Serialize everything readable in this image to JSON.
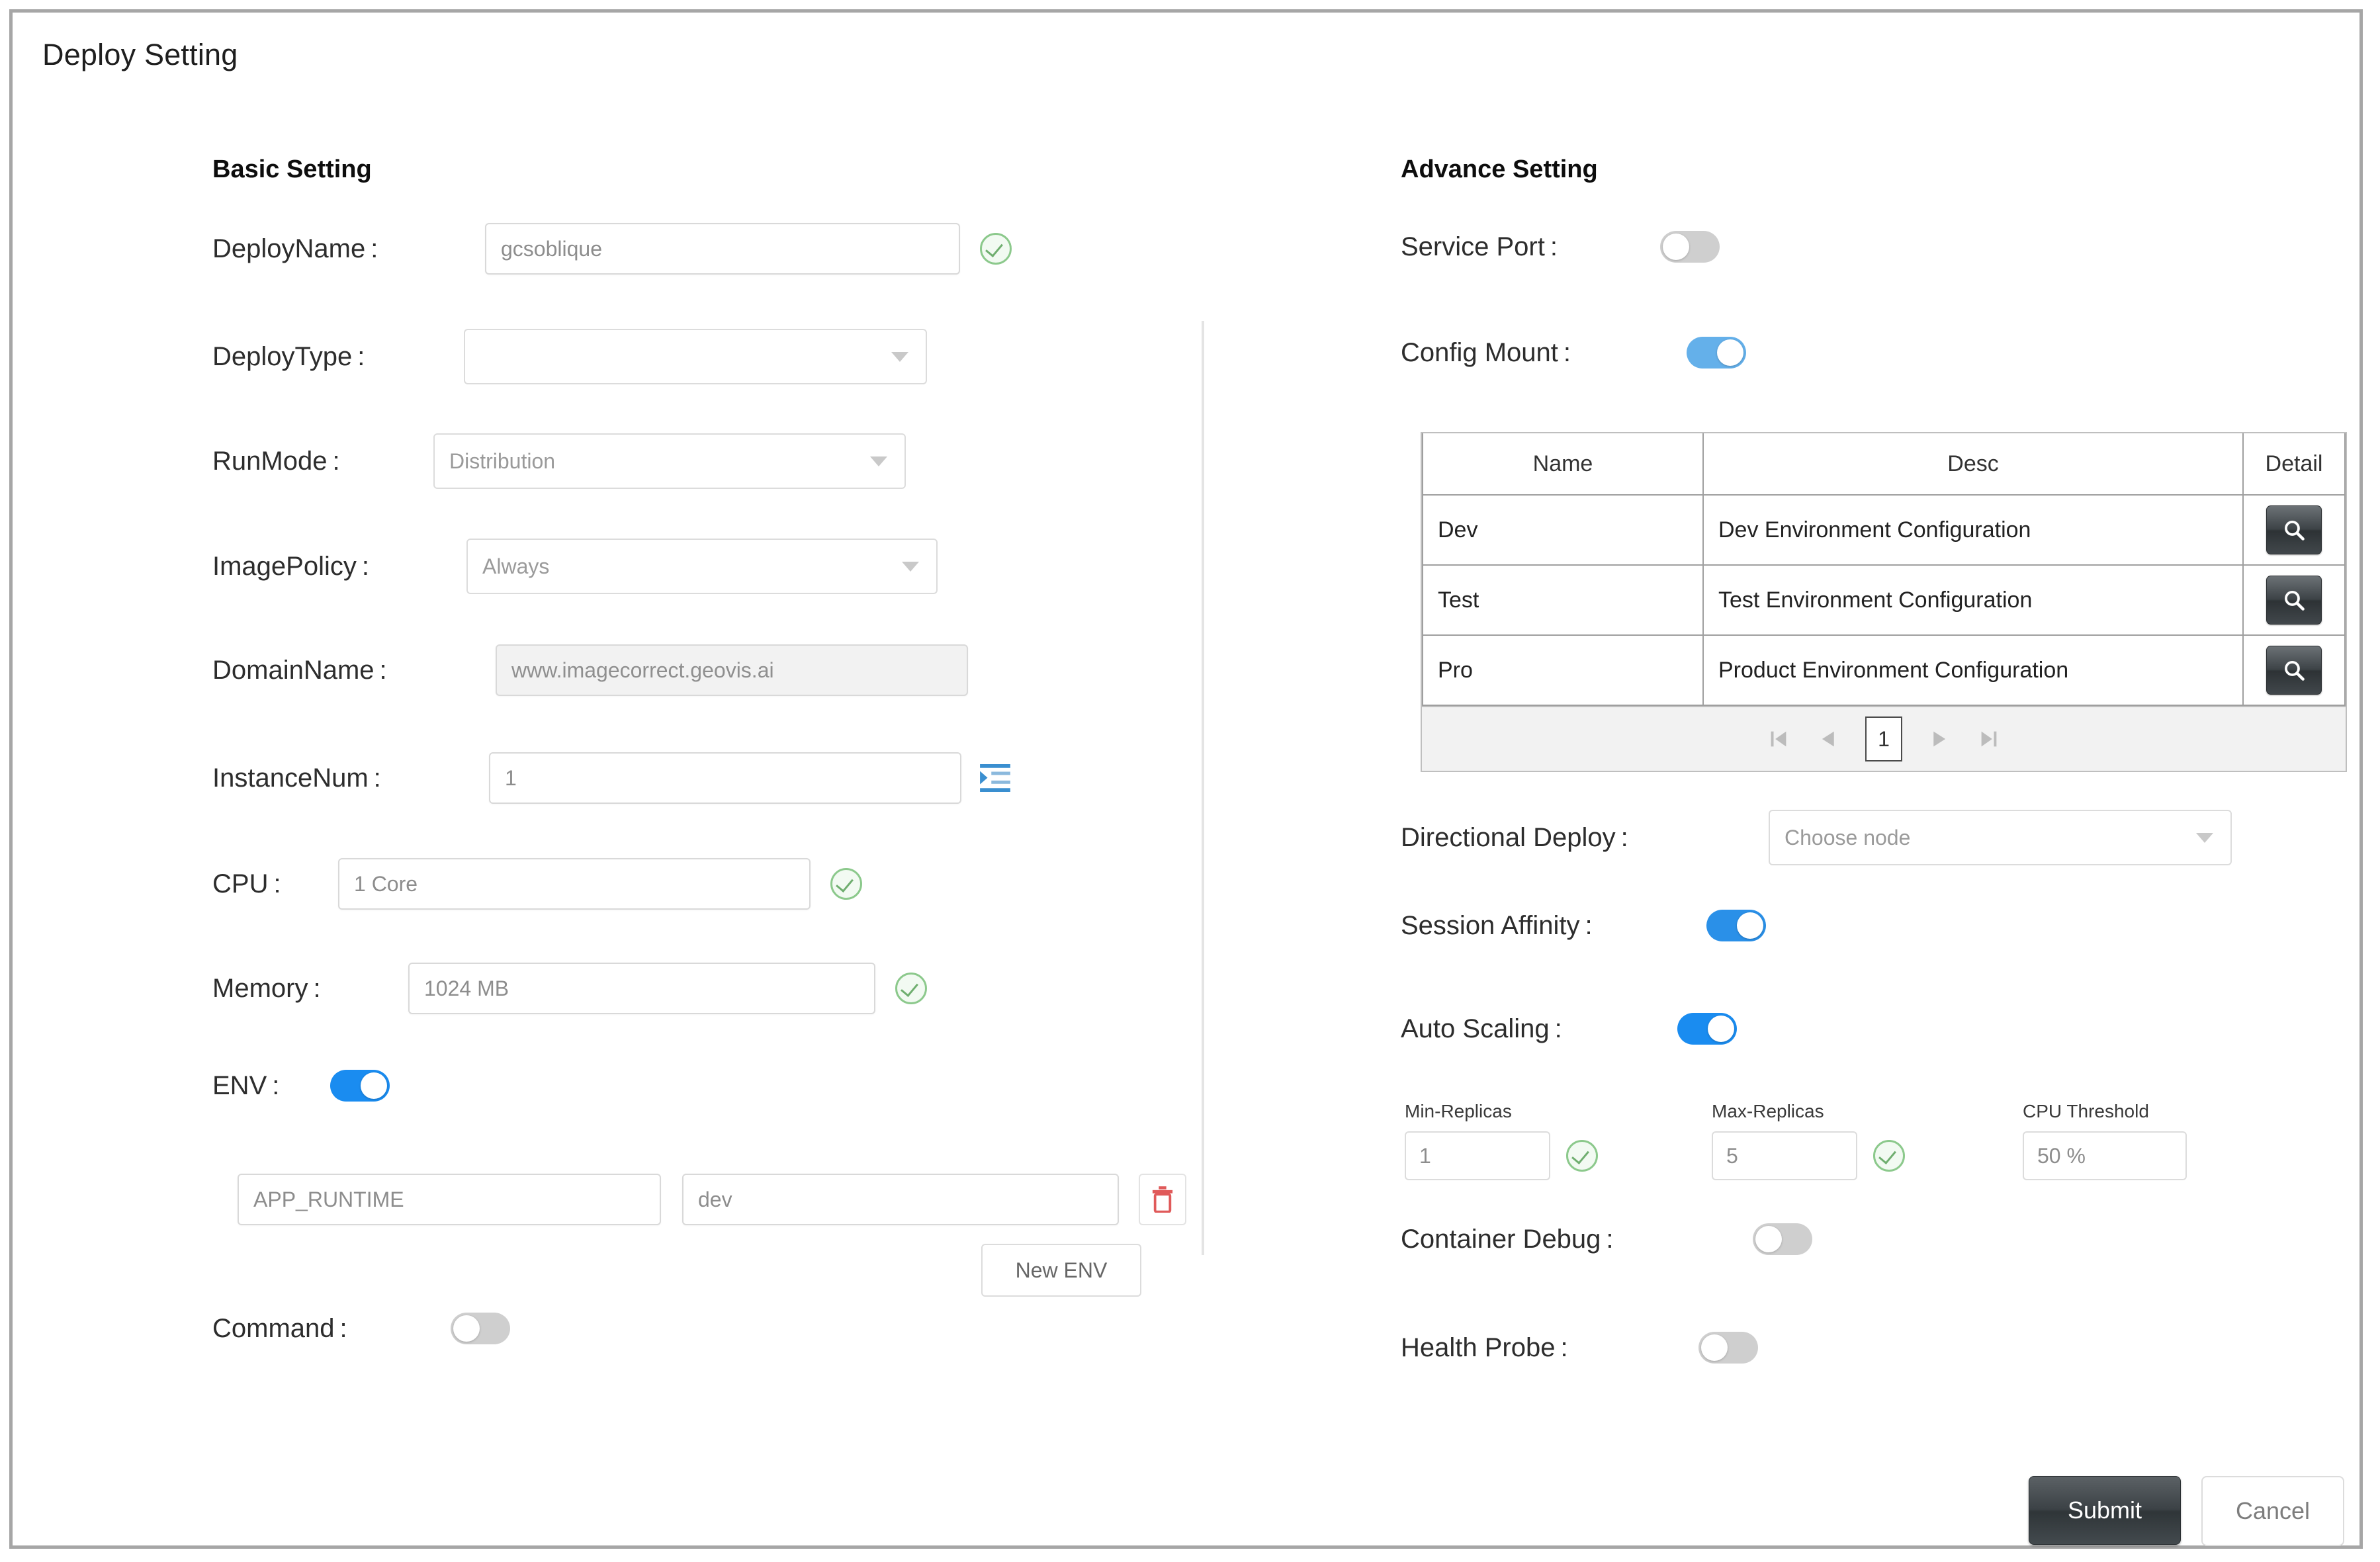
{
  "dialog": {
    "title": "Deploy Setting"
  },
  "basic": {
    "heading": "Basic Setting",
    "deploy_name": {
      "label": "DeployName :",
      "value": "gcsoblique",
      "valid": "valid-check-icon"
    },
    "deploy_type": {
      "label": "DeployType :",
      "value": "",
      "placeholder": ""
    },
    "run_mode": {
      "label": "RunMode :",
      "value": "Distribution"
    },
    "image_policy": {
      "label": "ImagePolicy :",
      "value": "Always"
    },
    "domain_name": {
      "label": "DomainName :",
      "value": "www.imagecorrect.geovis.ai"
    },
    "instance_num": {
      "label": "InstanceNum :",
      "value": "1"
    },
    "cpu": {
      "label": "CPU :",
      "value": "1 Core"
    },
    "memory": {
      "label": "Memory :",
      "value": "1024 MB"
    },
    "env": {
      "label": "ENV :",
      "enabled": "on",
      "rows": [
        {
          "key": "APP_RUNTIME",
          "value": "dev"
        }
      ],
      "new_env_label": "New ENV"
    },
    "command": {
      "label": "Command :",
      "enabled": "off"
    }
  },
  "advance": {
    "heading": "Advance Setting",
    "service_port": {
      "label": "Service Port :",
      "enabled": "off"
    },
    "config_mount": {
      "label": "Config Mount :",
      "enabled": "on",
      "table": {
        "columns": [
          "Name",
          "Desc",
          "Detail"
        ],
        "rows": [
          {
            "name": "Dev",
            "desc": "Dev Environment Configuration",
            "detail": "search-icon"
          },
          {
            "name": "Test",
            "desc": "Test Environment Configuration",
            "detail": "search-icon"
          },
          {
            "name": "Pro",
            "desc": "Product Environment Configuration",
            "detail": "search-icon"
          }
        ],
        "pagination": {
          "first": "⏮",
          "prev": "◀",
          "page": "1",
          "next": "▶",
          "last": "⏭"
        }
      }
    },
    "directional_deploy": {
      "label": "Directional Deploy :",
      "placeholder": "Choose node",
      "value": ""
    },
    "session_affinity": {
      "label": "Session Affinity :",
      "enabled": "on"
    },
    "auto_scaling": {
      "label": "Auto Scaling :",
      "enabled": "on",
      "min_replicas": {
        "label": "Min-Replicas",
        "value": "1"
      },
      "max_replicas": {
        "label": "Max-Replicas",
        "value": "5"
      },
      "cpu_threshold": {
        "label": "CPU Threshold",
        "value": "50 %"
      }
    },
    "container_debug": {
      "label": "Container Debug :",
      "enabled": "off"
    },
    "health_probe": {
      "label": "Health Probe :",
      "enabled": "off"
    }
  },
  "footer": {
    "submit_label": "Submit",
    "cancel_label": "Cancel"
  },
  "colors": {
    "toggle_on": "#1a8cf0",
    "toggle_on_light": "#64b0ea",
    "toggle_off": "#cfcfcf",
    "valid_green": "#8cc98c",
    "delete_red": "#e05a5a",
    "accent_blue": "#2f8fd8",
    "submit_dark": "#3a4044"
  }
}
